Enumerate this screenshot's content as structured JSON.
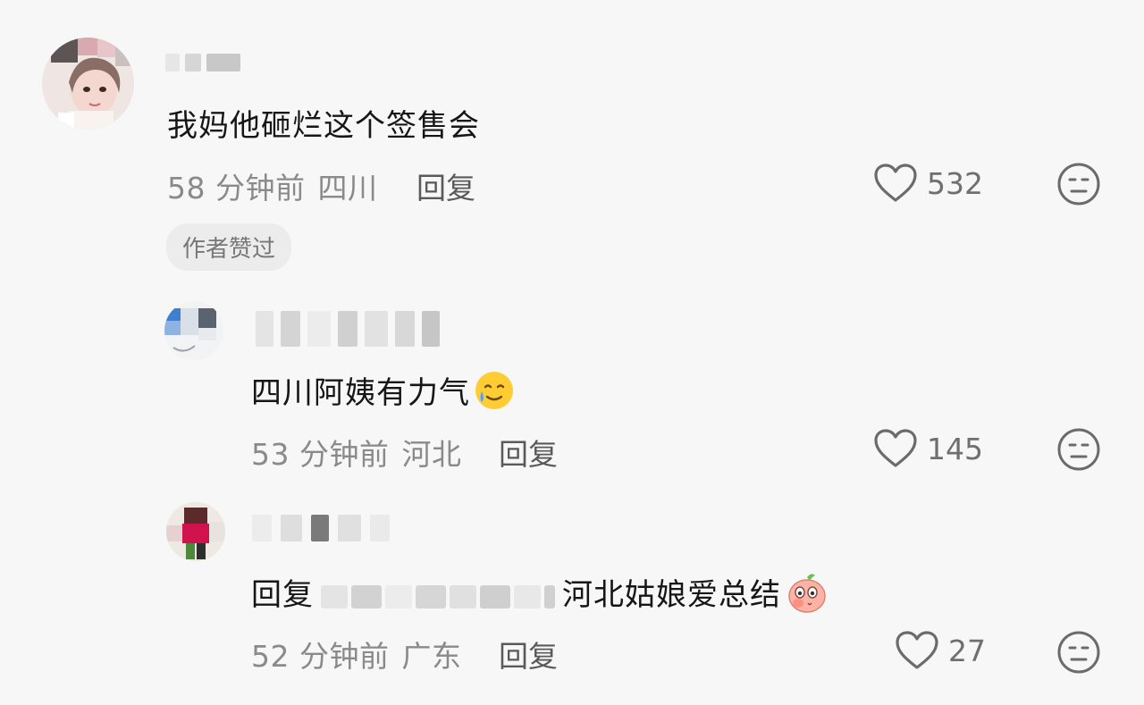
{
  "comments": [
    {
      "text": "我妈他砸烂这个签售会",
      "time": "58 分钟前",
      "location": "四川",
      "reply_label": "回复",
      "likes": "532",
      "badge": "作者赞过"
    },
    {
      "text": "四川阿姨有力气",
      "time": "53 分钟前",
      "location": "河北",
      "reply_label": "回复",
      "likes": "145"
    },
    {
      "reply_prefix": "回复",
      "text": "河北姑娘爱总结",
      "time": "52 分钟前",
      "location": "广东",
      "reply_label": "回复",
      "likes": "27"
    }
  ]
}
